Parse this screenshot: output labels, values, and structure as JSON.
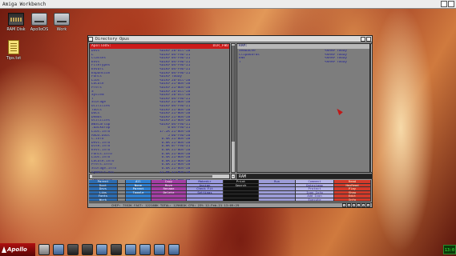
{
  "workbench": {
    "title": "Amiga Workbench"
  },
  "desktop_icons": [
    {
      "name": "ram-disk-icon",
      "label": "RAM Disk"
    },
    {
      "name": "drive-icon",
      "label": "ApolloOS"
    },
    {
      "name": "drive-icon",
      "label": "Work"
    },
    {
      "name": "text-file-icon",
      "label": "Tips.txt"
    }
  ],
  "dopus": {
    "title": "Directory Opus",
    "left": {
      "path": "ApolloOS:",
      "path_right": "DIR_FWD",
      "files": [
        {
          "n": "Devs",
          "s": "<DIR>",
          "d": "26-Oct-20",
          "t": ""
        },
        {
          "n": "L",
          "s": "<DIR>",
          "d": "04-Feb-21",
          "t": ""
        },
        {
          "n": "Classes",
          "s": "<DIR>",
          "d": "04-Feb-21",
          "t": ""
        },
        {
          "n": "Envs",
          "s": "<DIR>",
          "d": "04-Feb-21",
          "t": ""
        },
        {
          "n": "FileTypes",
          "s": "<DIR>",
          "d": "04-Feb-21",
          "t": ""
        },
        {
          "n": "Envarc",
          "s": "<DIR>",
          "d": "04-Feb-21",
          "t": ""
        },
        {
          "n": "Expansion",
          "s": "<DIR>",
          "d": "04-Feb-21",
          "t": ""
        },
        {
          "n": "Fonts",
          "s": "<DIR>",
          "d": "Today",
          "t": ""
        },
        {
          "n": "Libs",
          "s": "<DIR>",
          "d": "26-Oct-20",
          "t": ""
        },
        {
          "n": "Locale",
          "s": "<DIR>",
          "d": "21-Nov-20",
          "t": ""
        },
        {
          "n": "Prefs",
          "s": "<DIR>",
          "d": "21-Nov-20",
          "t": ""
        },
        {
          "n": "S",
          "s": "<DIR>",
          "d": "26-Oct-20",
          "t": ""
        },
        {
          "n": "System",
          "s": "<DIR>",
          "d": "26-Oct-20",
          "t": ""
        },
        {
          "n": "T",
          "s": "<DIR>",
          "d": "04-Feb-21",
          "t": ""
        },
        {
          "n": "Storage",
          "s": "<DIR>",
          "d": "21-Nov-20",
          "t": ""
        },
        {
          "n": "Utilities",
          "s": "<DIR>",
          "d": "04-Feb-21",
          "t": ""
        },
        {
          "n": "Tools",
          "s": "<DIR>",
          "d": "21-Nov-20",
          "t": ""
        },
        {
          "n": "Docs",
          "s": "<DIR>",
          "d": "21-Nov-20",
          "t": ""
        },
        {
          "n": "Demos",
          "s": "<DIR>",
          "d": "21-Nov-20",
          "t": ""
        },
        {
          "n": "Utilities",
          "s": "<DIR>",
          "d": "21-Nov-20",
          "t": ""
        },
        {
          "n": "WBStartup",
          "s": "<DIR>",
          "d": "04-Feb-21",
          "t": ""
        },
        {
          "n": ".backdrop",
          "s": "0",
          "d": "04-Feb-21",
          "t": ""
        },
        {
          "n": "Libs.info",
          "s": "17.2K",
          "d": "21-Nov-20",
          "t": ""
        },
        {
          "n": "AROS.boot",
          "s": "5",
          "d": "06-Feb-20",
          "t": ""
        },
        {
          "n": "C.info",
          "s": "6.4K",
          "d": "21-Nov-20",
          "t": ""
        },
        {
          "n": "Devs.info",
          "s": "6.8K",
          "d": "21-Nov-20",
          "t": ""
        },
        {
          "n": "Disk.info",
          "s": "6.8K",
          "d": "07-Feb-21",
          "t": ""
        },
        {
          "n": "Envs.info",
          "s": "6.6K",
          "d": "21-Nov-20",
          "t": ""
        },
        {
          "n": "Fonts.info",
          "s": "6.6K",
          "d": "21-Nov-20",
          "t": ""
        },
        {
          "n": "Libs.info",
          "s": "6.4K",
          "d": "21-Nov-20",
          "t": ""
        },
        {
          "n": "Locale.info",
          "s": "6.6K",
          "d": "21-Nov-20",
          "t": ""
        },
        {
          "n": "Prefs.info",
          "s": "6.6K",
          "d": "21-Nov-20",
          "t": ""
        },
        {
          "n": "Storage.info",
          "s": "6.6K",
          "d": "21-Nov-20",
          "t": ""
        },
        {
          "n": "symbols.out",
          "s": "22.8K",
          "d": "21-Nov-20",
          "t": ""
        },
        {
          "n": "System.info",
          "s": "6.6K",
          "d": "21-Nov-20",
          "t": ""
        },
        {
          "n": "Tools.info",
          "s": "6.6K",
          "d": "21-Nov-20",
          "t": ""
        },
        {
          "n": "Utilities.info",
          "s": "6.6K",
          "d": "21-Nov-20",
          "t": ""
        },
        {
          "n": "WBStartup.info",
          "s": "6.4K",
          "d": "21-Nov-20",
          "t": ""
        }
      ]
    },
    "right": {
      "path": "RAM:",
      "files": [
        {
          "n": "Sembache",
          "s": "<RAM>",
          "d": "Today",
          "t": ""
        },
        {
          "n": "Clipboards",
          "s": "<RAM>",
          "d": "Today",
          "t": ""
        },
        {
          "n": "ENV",
          "s": "<RAM>",
          "d": "Today",
          "t": ""
        },
        {
          "n": "T",
          "s": "<RAM>",
          "d": "Today",
          "t": ""
        }
      ]
    },
    "right_hbar_label": "RAM",
    "buttons": [
      {
        "color": "#2b6bb0",
        "fg": "#e8f0ff",
        "items": [
          "Parent",
          "Root",
          "Devs",
          "Libs",
          "Fonts",
          "Work"
        ]
      },
      {
        "color": "#888888",
        "fg": "#111",
        "items": [
          "",
          "",
          "",
          "",
          "",
          ""
        ]
      },
      {
        "color": "#2f7fd0",
        "fg": "#ffffff",
        "items": [
          "All",
          "None",
          "Parent",
          "Toggle",
          "",
          ""
        ]
      },
      {
        "color": "#a33ea3",
        "fg": "#fff0ff",
        "items": [
          "Copy",
          "Move",
          "Rename",
          "Delete",
          "",
          ""
        ]
      },
      {
        "color": "#9a9ae0",
        "fg": "#14146a",
        "items": [
          "Makedir",
          "Assign",
          "Check Fit",
          "Settings",
          "",
          ""
        ]
      },
      {
        "color": "#111111",
        "fg": "#f0f0f0",
        "items": [
          "Print",
          "Search",
          "",
          "",
          "",
          ""
        ]
      },
      {
        "color": "#9b9bd8",
        "fg": "#14146a",
        "items": [
          "Run",
          "",
          "",
          "",
          "",
          ""
        ]
      },
      {
        "color": "#b4b4e8",
        "fg": "#3a2a8a",
        "items": [
          "Comment",
          "Datestamp",
          "Protect",
          "Icon Info",
          "Add Icon",
          "Execute"
        ]
      },
      {
        "color": "#d33a2a",
        "fg": "#fff2d0",
        "items": [
          "Read",
          "HexRead",
          "Play",
          "Show",
          "Edit",
          "Info"
        ]
      }
    ],
    "status": "CHIP: 7552K  FAST: 122168K  TOTAL: 129681K  CPU: 23%   12-Feb-21   13:09:29",
    "status_arrows": [
      "?",
      "E",
      "F",
      "C",
      "I",
      "Q"
    ]
  },
  "taskbar": {
    "start_label": "Apollo",
    "clock": "13:0"
  }
}
